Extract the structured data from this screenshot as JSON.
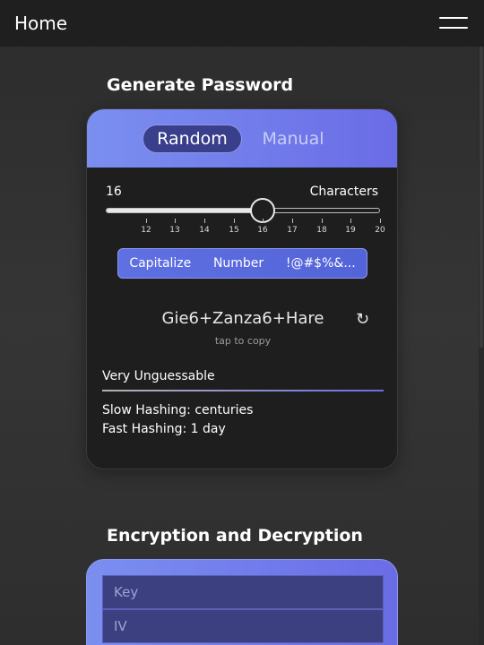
{
  "header": {
    "title": "Home"
  },
  "generator": {
    "section_title": "Generate Password",
    "modes": [
      "Random",
      "Manual"
    ],
    "length": "16",
    "length_unit": "Characters",
    "slider": {
      "min": 11,
      "max": 20,
      "value": 16
    },
    "tick_labels": [
      "12",
      "13",
      "14",
      "15",
      "16",
      "17",
      "18",
      "19",
      "20"
    ],
    "options": [
      "Capitalize",
      "Number",
      "!@#$%&..."
    ],
    "password": "Gie6+Zanza6+Hare",
    "refresh_icon": "refresh-icon",
    "copy_hint": "tap to copy",
    "strength": "Very Unguessable",
    "slow_hashing": "Slow Hashing: centuries",
    "fast_hashing": "Fast Hashing: 1 day"
  },
  "crypto": {
    "section_title": "Encryption and Decryption",
    "key_placeholder": "Key",
    "iv_placeholder": "IV"
  },
  "colors": {
    "accent_start": "#7b8ff0",
    "accent_end": "#6a6ce6",
    "active_segment": "#3a3f8c",
    "options_bar": "#5f70e2",
    "card_bg": "#1e1e1e"
  }
}
